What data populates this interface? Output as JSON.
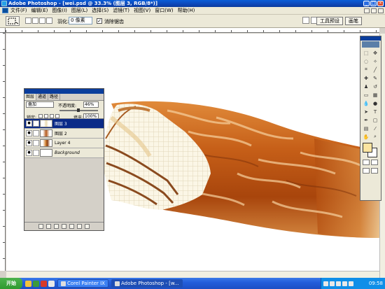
{
  "window": {
    "title": "Adobe Photoshop - [wei.psd @ 33.3% (图层 3, RGB/8*)]"
  },
  "menu": {
    "items": [
      "文件(F)",
      "编辑(E)",
      "图像(I)",
      "图层(L)",
      "选择(S)",
      "滤镜(T)",
      "视图(V)",
      "窗口(W)",
      "帮助(H)"
    ]
  },
  "options": {
    "feather_label": "羽化:",
    "feather_value": "0 像素",
    "antialias_label": "消除锯齿",
    "tabs": [
      "工具预设",
      "画笔"
    ]
  },
  "layers_panel": {
    "tabs": [
      "图层",
      "通道",
      "路径"
    ],
    "blend_mode": "叠加",
    "opacity_label": "不透明度:",
    "opacity": "46%",
    "opacity_fraction": 0.46,
    "lock_label": "锁定:",
    "fill_label": "填充:",
    "fill": "100%",
    "layers": [
      {
        "name": "图层 3",
        "selected": true,
        "thumb": "t-wafer"
      },
      {
        "name": "图层 2",
        "selected": false,
        "thumb": "t-choc"
      },
      {
        "name": "Layer 4",
        "selected": false,
        "thumb": "t-l4"
      },
      {
        "name": "Background",
        "selected": false,
        "thumb": ""
      }
    ]
  },
  "toolbox": {
    "foreground_color": "#fbe4a0",
    "background_color": "#ffffff"
  },
  "taskbar": {
    "start_label": "开始",
    "tasks": [
      {
        "label": "Corel Painter IX",
        "active": false
      },
      {
        "label": "Adobe Photoshop - [w...",
        "active": true
      }
    ],
    "clock": "09:58"
  }
}
